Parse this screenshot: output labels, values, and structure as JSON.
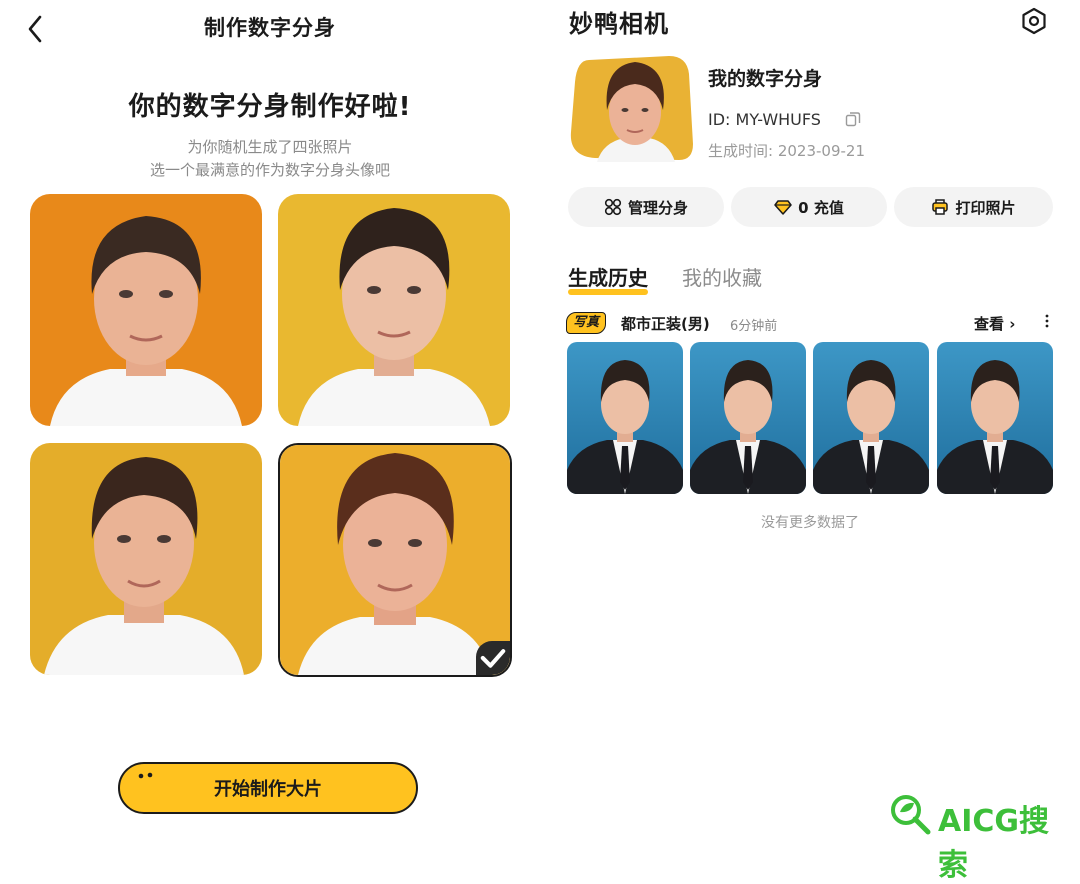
{
  "left": {
    "title": "制作数字分身",
    "headline": "你的数字分身制作好啦!",
    "subtitle_line1": "为你随机生成了四张照片",
    "subtitle_line2": "选一个最满意的作为数字分身头像吧",
    "selected_index": 4,
    "start_button_label": "开始制作大片",
    "colors": {
      "accent": "#ffc21f",
      "photo_bg_1": "#e8891a",
      "photo_bg_2": "#e9b830",
      "photo_bg_3": "#e4ad2a",
      "photo_bg_4": "#ecae2c"
    }
  },
  "right": {
    "brand": "妙鸭相机",
    "profile": {
      "name": "我的数字分身",
      "id_text": "ID: MY-WHUFS",
      "date_text": "生成时间: 2023-09-21"
    },
    "actions": [
      {
        "label": "管理分身",
        "icon": "grid-icon"
      },
      {
        "label": "0 充值",
        "icon": "diamond-icon"
      },
      {
        "label": "打印照片",
        "icon": "printer-icon"
      }
    ],
    "tabs": [
      {
        "label": "生成历史",
        "active": true
      },
      {
        "label": "我的收藏",
        "active": false
      }
    ],
    "record": {
      "tag": "写真",
      "style": "都市正装(男)",
      "time": "6分钟前",
      "view_label": "查看"
    },
    "no_more_text": "没有更多数据了",
    "colors": {
      "thumb_bg": "#2f86b6",
      "suit": "#1d1f24"
    }
  },
  "watermark": {
    "text": "AICG搜索",
    "color": "#3dbf3a"
  }
}
